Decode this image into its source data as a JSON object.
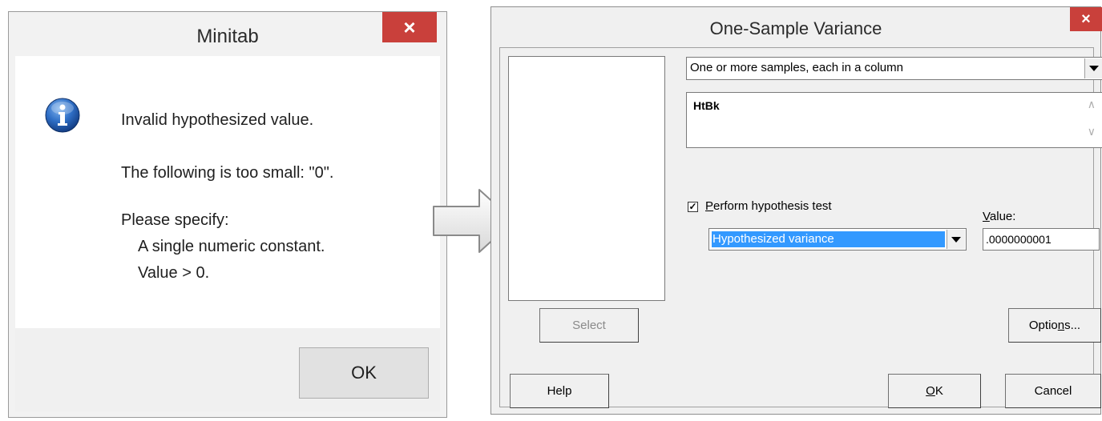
{
  "error_dialog": {
    "title": "Minitab",
    "close_label": "×",
    "icon": "info-icon",
    "message_line1": "Invalid hypothesized value.",
    "message_line2": "The following is too small: \"0\".",
    "message_line3": "Please specify:",
    "message_line4": "A single numeric constant.",
    "message_line5": "Value > 0.",
    "ok_label": "OK"
  },
  "arrow_icon": "right-arrow-icon",
  "variance_dialog": {
    "title": "One-Sample Variance",
    "close_label": "×",
    "data_mode": "One or more samples, each in a column",
    "samples_text": "HtBk",
    "perform_test_checked": true,
    "perform_test_label_accel": "P",
    "perform_test_label_rest": "erform hypothesis test",
    "test_type": "Hypothesized variance",
    "value_label_accel": "V",
    "value_label_rest": "alue:",
    "value": ".0000000001",
    "select_label": "Select",
    "options_label_pre": "Optio",
    "options_label_accel": "n",
    "options_label_post": "s...",
    "help_label": "Help",
    "ok_label_accel": "O",
    "ok_label_rest": "K",
    "cancel_label": "Cancel"
  },
  "colors": {
    "close_button": "#c9403b",
    "selection_highlight": "#3399ff"
  }
}
